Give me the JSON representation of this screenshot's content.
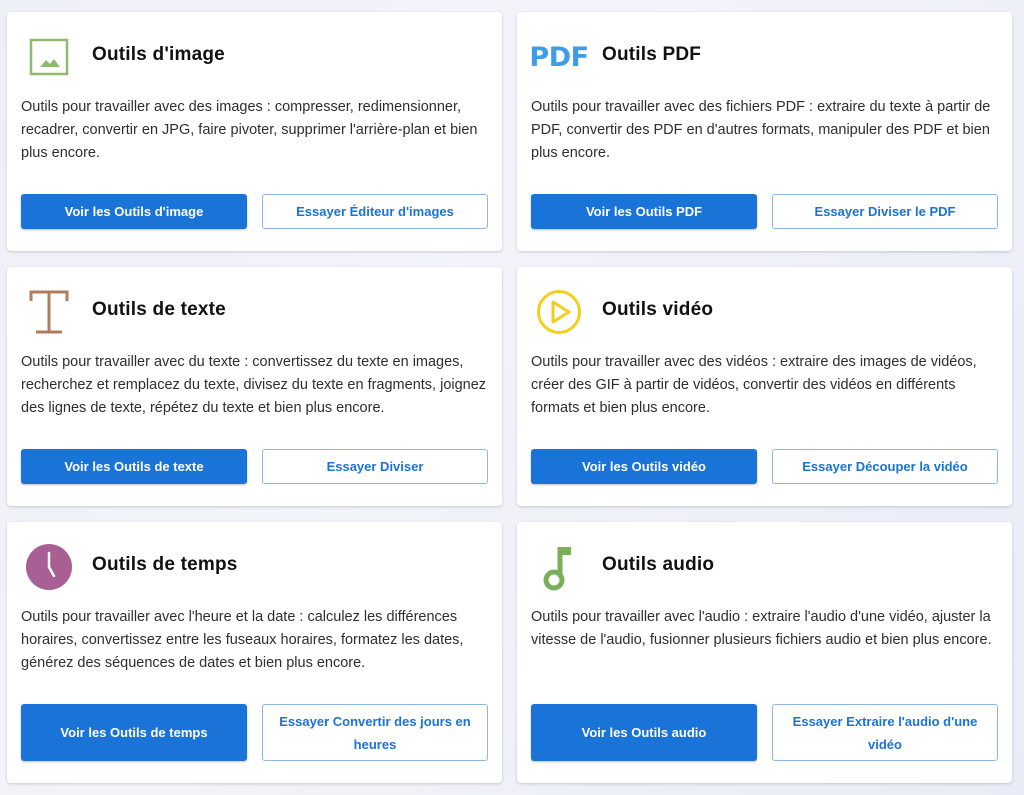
{
  "cards": [
    {
      "title": "Outils d'image",
      "description": "Outils pour travailler avec des images : compresser, redimensionner, recadrer, convertir en JPG, faire pivoter, supprimer l'arrière-plan et bien plus encore.",
      "primary_label": "Voir les Outils d'image",
      "secondary_label": "Essayer Éditeur d'images",
      "icon": "image-icon",
      "icon_color": "#8fba6b"
    },
    {
      "title": "Outils PDF",
      "description": "Outils pour travailler avec des fichiers PDF : extraire du texte à partir de PDF, convertir des PDF en d'autres formats, manipuler des PDF et bien plus encore.",
      "primary_label": "Voir les Outils PDF",
      "secondary_label": "Essayer Diviser le PDF",
      "icon": "pdf-icon",
      "icon_text": "PDF",
      "icon_color": "#3b9ee6"
    },
    {
      "title": "Outils de texte",
      "description": "Outils pour travailler avec du texte : convertissez du texte en images, recherchez et remplacez du texte, divisez du texte en fragments, joignez des lignes de texte, répétez du texte et bien plus encore.",
      "primary_label": "Voir les Outils de texte",
      "secondary_label": "Essayer Diviser",
      "icon": "text-icon",
      "icon_color": "#b07d5c"
    },
    {
      "title": "Outils vidéo",
      "description": "Outils pour travailler avec des vidéos : extraire des images de vidéos, créer des GIF à partir de vidéos, convertir des vidéos en différents formats et bien plus encore.",
      "primary_label": "Voir les Outils vidéo",
      "secondary_label": "Essayer Découper la vidéo",
      "icon": "play-icon",
      "icon_color": "#f2cf1b"
    },
    {
      "title": "Outils de temps",
      "description": "Outils pour travailler avec l'heure et la date : calculez les différences horaires, convertissez entre les fuseaux horaires, formatez les dates, générez des séquences de dates et bien plus encore.",
      "primary_label": "Voir les Outils de temps",
      "secondary_label": "Essayer Convertir des jours en heures",
      "icon": "clock-icon",
      "icon_color": "#a85f93"
    },
    {
      "title": "Outils audio",
      "description": "Outils pour travailler avec l'audio : extraire l'audio d'une vidéo, ajuster la vitesse de l'audio, fusionner plusieurs fichiers audio et bien plus encore.",
      "primary_label": "Voir les Outils audio",
      "secondary_label": "Essayer Extraire l'audio d'une vidéo",
      "icon": "music-note-icon",
      "icon_color": "#7ab05a"
    }
  ],
  "colors": {
    "primary": "#1a73d6",
    "secondary_border": "#8cb6e8",
    "card_bg": "#ffffff",
    "page_bg": "#eef0f6"
  }
}
